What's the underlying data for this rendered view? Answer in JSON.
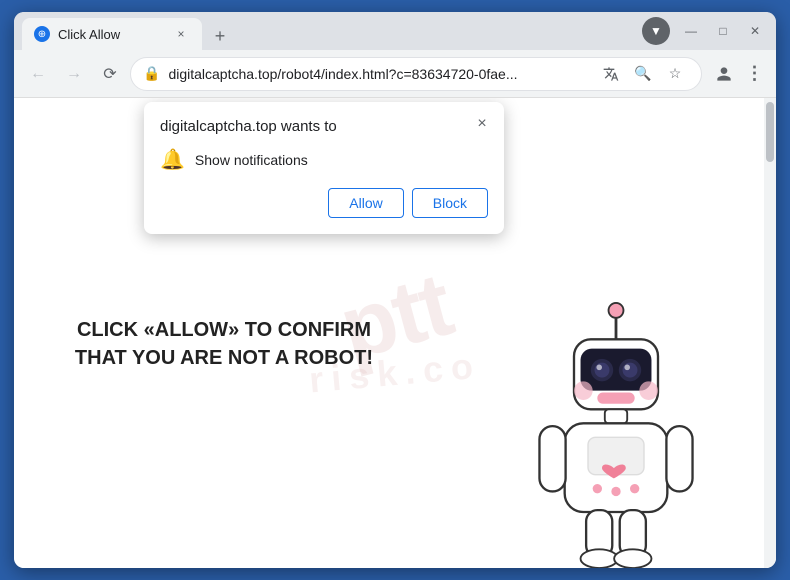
{
  "browser": {
    "tab_title": "Click Allow",
    "tab_close_label": "×",
    "new_tab_icon": "+",
    "window_controls": {
      "minimize": "—",
      "maximize": "□",
      "close": "✕"
    }
  },
  "address_bar": {
    "url": "digitalcaptcha.top/robot4/index.html?c=83634720-0fae...",
    "lock_icon": "🔒"
  },
  "toolbar_icons": {
    "translate": "⊞",
    "search": "🔍",
    "star": "☆",
    "profile": "👤",
    "menu": "⋮"
  },
  "notification_popup": {
    "title": "digitalcaptcha.top wants to",
    "permission_label": "Show notifications",
    "close_icon": "×",
    "allow_button": "Allow",
    "block_button": "Block"
  },
  "page": {
    "main_text": "CLICK «ALLOW» TO CONFIRM THAT YOU ARE NOT A ROBOT!",
    "watermark_line1": "ptt",
    "watermark_line2": "risk.co"
  }
}
